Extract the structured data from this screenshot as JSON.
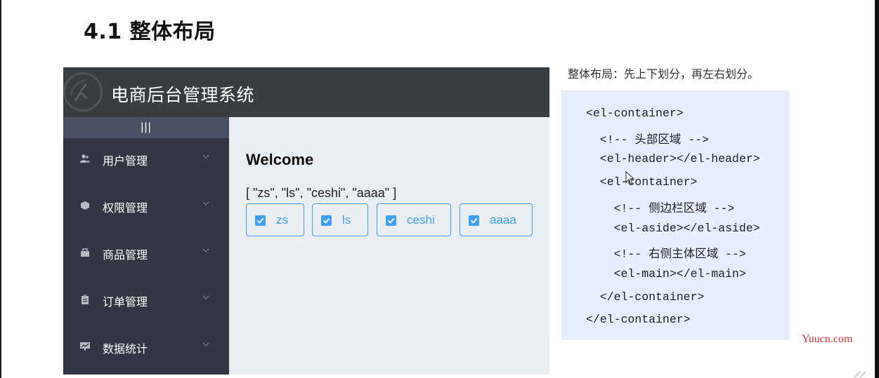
{
  "slide": {
    "title": "4.1 整体布局",
    "note": "整体布局：先上下划分，再左右划分。",
    "watermark": "Yuucn.com"
  },
  "app": {
    "title": "电商后台管理系统",
    "toggle_label": "|||",
    "menu": [
      {
        "label": "用户管理",
        "icon": "users-icon"
      },
      {
        "label": "权限管理",
        "icon": "cube-icon"
      },
      {
        "label": "商品管理",
        "icon": "bag-icon"
      },
      {
        "label": "订单管理",
        "icon": "clipboard-icon"
      },
      {
        "label": "数据统计",
        "icon": "chart-icon"
      }
    ],
    "main": {
      "welcome": "Welcome",
      "list_text": "[ \"zs\", \"ls\", \"ceshi\", \"aaaa\" ]",
      "checkboxes": [
        {
          "label": "zs",
          "checked": true
        },
        {
          "label": "ls",
          "checked": true
        },
        {
          "label": "ceshi",
          "checked": true
        },
        {
          "label": "aaaa",
          "checked": true
        }
      ]
    }
  },
  "code": [
    "<el-container>",
    "  <!-- 头部区域 -->",
    "  <el-header></el-header>",
    "  <el-container>",
    "    <!-- 侧边栏区域 -->",
    "    <el-aside></el-aside>",
    "    <!-- 右侧主体区域 -->",
    "    <el-main></el-main>",
    "  </el-container>",
    "</el-container>"
  ],
  "colors": {
    "header_bg": "#373d41",
    "aside_bg": "#333744",
    "main_bg": "#eaedf1",
    "accent": "#409eff",
    "code_bg": "#e5efff"
  }
}
